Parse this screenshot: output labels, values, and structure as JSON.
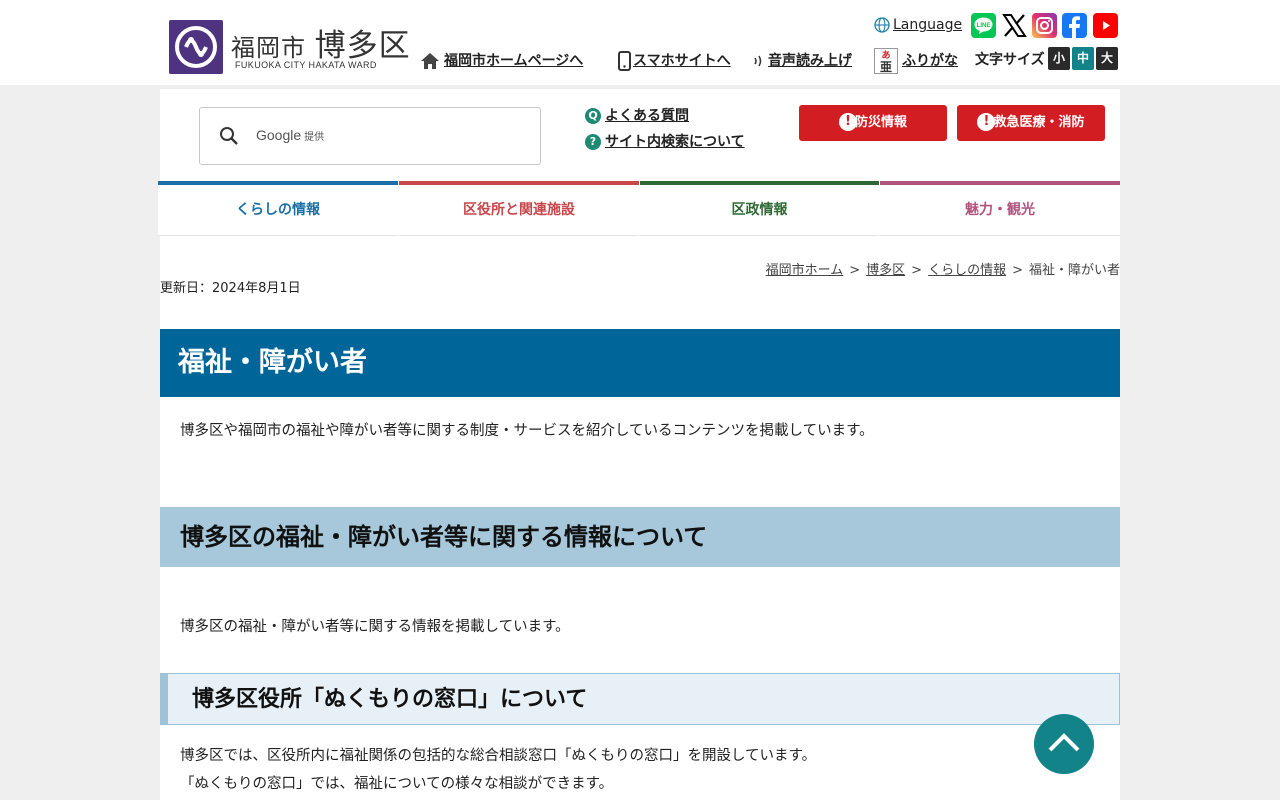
{
  "header": {
    "logo_city": "福岡市",
    "logo_ward": "博多区",
    "logo_en": "FUKUOKA CITY HAKATA WARD",
    "links": {
      "home": "福岡市ホームページへ",
      "mobile": "スマホサイトへ",
      "voice": "音声読み上げ",
      "furigana": "ふりがな"
    },
    "language": "Language",
    "font_size_label": "文字サイズ",
    "font_sizes": [
      "小",
      "中",
      "大"
    ],
    "colors": {
      "line": "#06c755",
      "x": "#000000",
      "facebook": "#1877f2",
      "youtube": "#ff0000",
      "logo": "#4e3381"
    }
  },
  "search": {
    "provider": "Google",
    "provider_suffix": "提供"
  },
  "quick_links": {
    "faq": "よくある質問",
    "about_search": "サイト内検索について"
  },
  "emergency": {
    "disaster": "防災情報",
    "medical": "救急医療・消防",
    "color": "#d21d22"
  },
  "nav": {
    "tabs": [
      {
        "label": "くらしの情報",
        "color": "#1b6fa8"
      },
      {
        "label": "区役所と関連施設",
        "color": "#c9464b"
      },
      {
        "label": "区政情報",
        "color": "#2f6a35"
      },
      {
        "label": "魅力・観光",
        "color": "#b2527f"
      }
    ]
  },
  "breadcrumb": {
    "items": [
      "福岡市ホーム",
      "博多区",
      "くらしの情報"
    ],
    "current": "福祉・障がい者",
    "separator": ">"
  },
  "page": {
    "updated": "更新日：2024年8月1日",
    "title": "福祉・障がい者",
    "intro": "博多区や福岡市の福祉や障がい者等に関する制度・サービスを紹介しているコンテンツを掲載しています。",
    "section_title": "博多区の福祉・障がい者等に関する情報について",
    "section_text": "博多区の福祉・障がい者等に関する情報を掲載しています。",
    "subsection_title": "博多区役所「ぬくもりの窓口」について",
    "subsection_text_1": "博多区では、区役所内に福祉関係の包括的な総合相談窓口「ぬくもりの窓口」を開設しています。",
    "subsection_text_2": "「ぬくもりの窓口」では、福祉についての様々な相談ができます。"
  }
}
